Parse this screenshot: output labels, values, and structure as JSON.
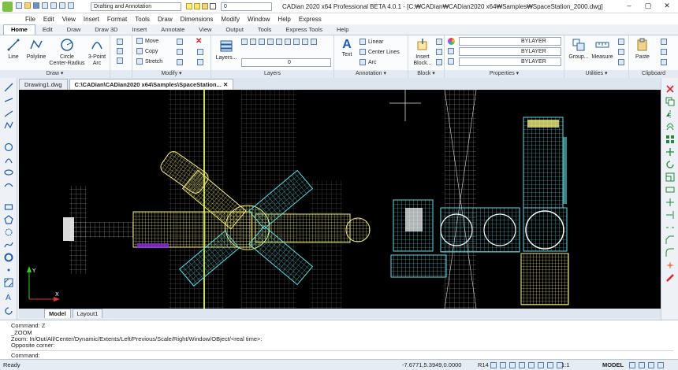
{
  "titlebar": {
    "workspace": "Drafting and Annotation",
    "layer_value": "0",
    "title": "CADian 2020 x64 Professional BETA 4.0.1 - [C:₩CADian₩CADian2020 x64₩Samples₩SpaceStation_2000.dwg]"
  },
  "menu": [
    "File",
    "Edit",
    "View",
    "Insert",
    "Format",
    "Tools",
    "Draw",
    "Dimensions",
    "Modify",
    "Window",
    "Help",
    "Express"
  ],
  "ribbon_tabs": [
    "Home",
    "Edit",
    "Draw",
    "Draw 3D",
    "Insert",
    "Annotate",
    "View",
    "Output",
    "Tools",
    "Express Tools",
    "Help"
  ],
  "ribbon": {
    "draw": {
      "title": "Draw ▾",
      "line": "Line",
      "polyline": "Polyline",
      "circle": "Circle",
      "circle_sub": "Center-Radius",
      "arc": "3-Point",
      "arc_sub": "Arc"
    },
    "modify": {
      "title": "Modify ▾",
      "move": "Move",
      "copy": "Copy",
      "stretch": "Stretch"
    },
    "layers": {
      "title": "Layers",
      "layers_btn": "Layers...",
      "layer_value": "0"
    },
    "annotation": {
      "title": "Annotation ▾",
      "text": "Text",
      "linear": "Linear",
      "center_lines": "Center Lines",
      "arc": "Arc"
    },
    "block": {
      "title": "Block ▾",
      "insert": "Insert",
      "insert_sub": "Block..."
    },
    "properties": {
      "title": "Properties ▾",
      "color": "BYLAYER",
      "linetype": "BYLAYER",
      "lineweight": "BYLAYER"
    },
    "utilities": {
      "title": "Utilities ▾",
      "group": "Group...",
      "measure": "Measure"
    },
    "clipboard": {
      "title": "Clipboard",
      "paste": "Paste"
    }
  },
  "doc_tabs": [
    "Drawing1.dwg",
    "C:\\CADian\\CADian2020 x64\\Samples\\SpaceStation..."
  ],
  "layout_tabs": [
    "Model",
    "Layout1"
  ],
  "command": {
    "lines": [
      "Command: Z",
      "_ZOOM",
      "Zoom:  In/Out/All/Center/Dynamic/Extents/Left/Previous/Scale/Right/Window/OBject/<real time>:",
      "Opposite corner:"
    ],
    "prompt": "Command:"
  },
  "status": {
    "ready": "Ready",
    "coords": "-7.6771,5.3949,0.0000",
    "r14": "R14",
    "scale": "1:1",
    "model": "MODEL"
  },
  "ucs": {
    "y": "Y",
    "x": "X"
  },
  "colors": {
    "accent": "#1f5fa8",
    "canvas": "#000000",
    "yellow": "#f3ef7a",
    "cyan": "#56e0e8"
  }
}
